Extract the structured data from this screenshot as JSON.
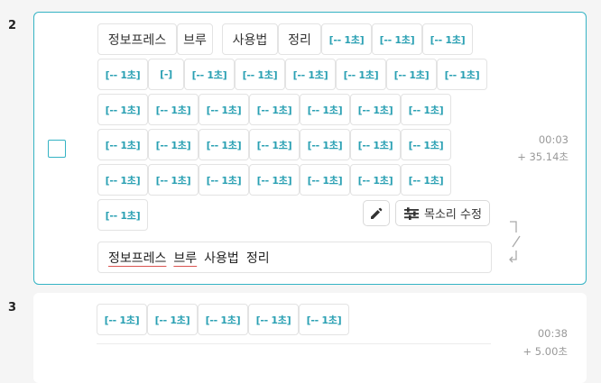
{
  "rows": [
    {
      "number": "2",
      "tokens": {
        "words": [
          "정보프레스",
          "브루",
          "사용법",
          "정리"
        ],
        "pause_label": "[-- 1초]",
        "short_pause_label": "[-]"
      },
      "time": "00:03",
      "duration": "+ 35.14초",
      "voice_edit_label": "목소리 수정",
      "text": [
        "정보프레스",
        "브루",
        "사용법",
        "정리"
      ]
    },
    {
      "number": "3",
      "tokens": {
        "pause_label": "[-- 1초]"
      },
      "time": "00:38",
      "duration": "+ 5.00초"
    }
  ],
  "colors": {
    "accent": "#35b3c4",
    "pause_text": "#2aa0b3",
    "error_underline": "#d9534f"
  },
  "icons": {
    "edit": "pencil-icon",
    "voice": "sliders-icon",
    "split": "split-arrow-icon"
  }
}
